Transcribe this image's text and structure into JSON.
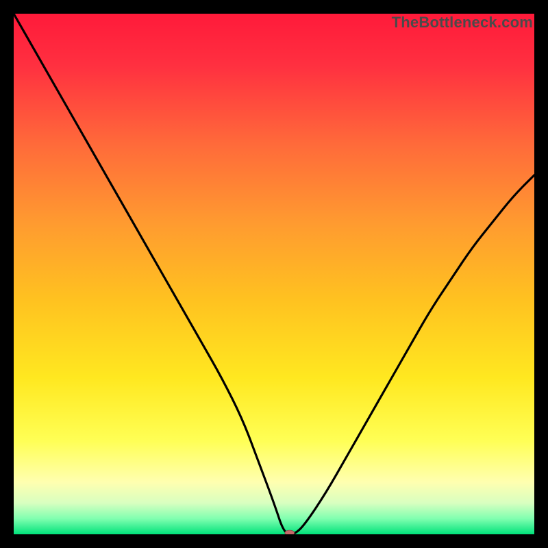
{
  "watermark": "TheBottleneck.com",
  "chart_data": {
    "type": "line",
    "title": "",
    "xlabel": "",
    "ylabel": "",
    "xlim": [
      0,
      100
    ],
    "ylim": [
      0,
      100
    ],
    "background_gradient": {
      "stops": [
        {
          "offset": 0.0,
          "color": "#ff1a3a"
        },
        {
          "offset": 0.1,
          "color": "#ff3040"
        },
        {
          "offset": 0.25,
          "color": "#ff6a3a"
        },
        {
          "offset": 0.4,
          "color": "#ff9a30"
        },
        {
          "offset": 0.55,
          "color": "#ffc220"
        },
        {
          "offset": 0.7,
          "color": "#ffe820"
        },
        {
          "offset": 0.82,
          "color": "#ffff55"
        },
        {
          "offset": 0.9,
          "color": "#ffffb0"
        },
        {
          "offset": 0.94,
          "color": "#d8ffc0"
        },
        {
          "offset": 0.97,
          "color": "#80ffb0"
        },
        {
          "offset": 1.0,
          "color": "#00e27a"
        }
      ]
    },
    "series": [
      {
        "name": "bottleneck-curve",
        "color": "#000000",
        "x": [
          0,
          4,
          8,
          12,
          16,
          20,
          24,
          28,
          32,
          36,
          40,
          44,
          47,
          50,
          52,
          54,
          56,
          60,
          64,
          68,
          72,
          76,
          80,
          84,
          88,
          92,
          96,
          100
        ],
        "y": [
          100,
          93,
          86,
          79,
          72,
          65,
          58,
          51,
          44,
          37,
          30,
          22,
          14,
          6,
          0,
          0,
          2,
          8,
          15,
          22,
          29,
          36,
          43,
          49,
          55,
          60,
          65,
          69
        ]
      }
    ],
    "marker": {
      "name": "current-point",
      "x": 53,
      "y": 0,
      "color": "#c46a6a",
      "rx": 7,
      "ry": 4
    }
  }
}
